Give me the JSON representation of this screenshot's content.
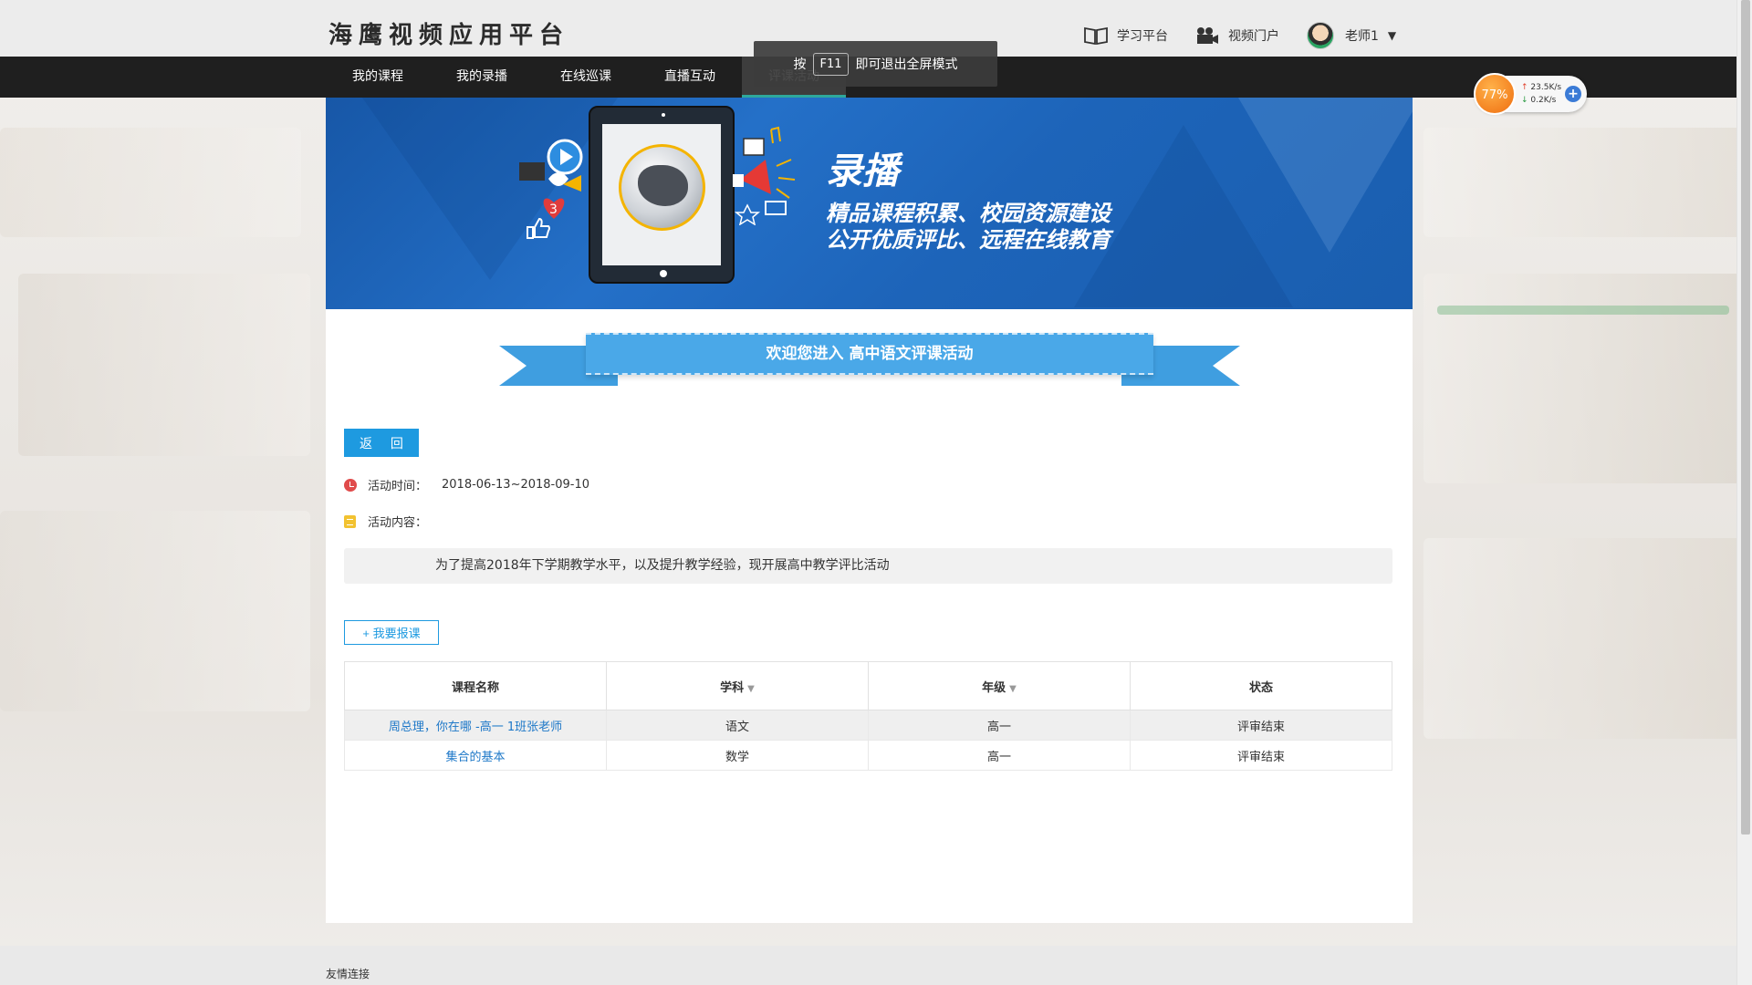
{
  "header": {
    "logo": "海鹰视频应用平台",
    "links": [
      {
        "label": "学习平台",
        "icon": "book-icon"
      },
      {
        "label": "视频门户",
        "icon": "video-camera-icon"
      }
    ],
    "user": {
      "name": "老师1",
      "caret": "▼"
    }
  },
  "nav": {
    "items": [
      "我的课程",
      "我的录播",
      "在线巡课",
      "直播互动",
      "评课活动"
    ],
    "active_index": 4
  },
  "fullscreen_tip": {
    "prefix": "按",
    "key": "F11",
    "suffix": "即可退出全屏模式"
  },
  "speed_widget": {
    "percent": "77%",
    "upload": "23.5K/s",
    "download": "0.2K/s",
    "plus": "+"
  },
  "banner": {
    "title": "录播",
    "line1": "精品课程积累、校园资源建设",
    "line2": "公开优质评比、远程在线教育"
  },
  "ribbon": {
    "text": "欢迎您进入 高中语文评课活动"
  },
  "back_button": "返 回",
  "activity": {
    "time_label": "活动时间：",
    "time_value": "2018-06-13~2018-09-10",
    "content_label": "活动内容：",
    "description": "为了提高2018年下学期教学水平，以及提升教学经验，现开展高中教学评比活动"
  },
  "signup_button": "+ 我要报课",
  "table": {
    "headers": [
      "课程名称",
      "学科",
      "年级",
      "状态"
    ],
    "rows": [
      {
        "name": "周总理，你在哪 -高一 1班张老师",
        "subject": "语文",
        "grade": "高一",
        "status": "评审结束"
      },
      {
        "name": "集合的基本",
        "subject": "数学",
        "grade": "高一",
        "status": "评审结束"
      }
    ]
  },
  "footer": {
    "title": "友情连接"
  },
  "colors": {
    "accent": "#1e9ae0",
    "nav_bg": "#1f1f1f",
    "banner": "#1d64b9",
    "active_tab": "#2ea89b"
  }
}
